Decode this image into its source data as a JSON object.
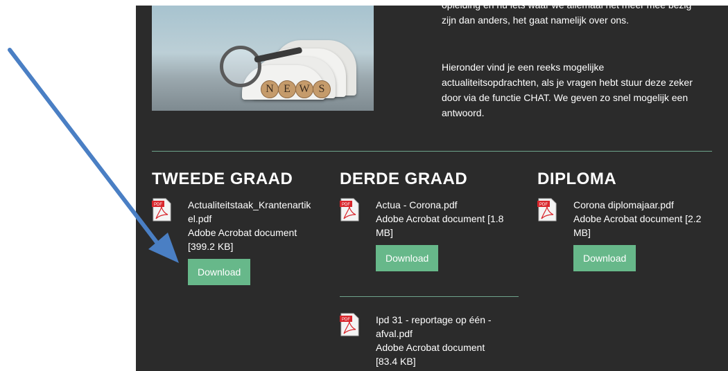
{
  "intro": {
    "line0": "opleiding en nu iets waar we allemaal het meer mee bezig",
    "line1": "zijn dan anders, het gaat namelijk over ons.",
    "para2_lines": [
      "Hieronder vind je een reeks mogelijke",
      "actualiteitsopdrachten, als je vragen hebt stuur deze zeker",
      "door via de functie CHAT. We geven zo snel mogelijk een",
      "antwoord."
    ]
  },
  "hero": {
    "letters": [
      "N",
      "E",
      "W",
      "S"
    ]
  },
  "columns": [
    {
      "title": "TWEEDE GRAAD",
      "files": [
        {
          "name_lines": [
            "Actualiteitstaak_Krantenartik",
            "el.pdf"
          ],
          "type_lines": [
            "Adobe Acrobat document",
            "[399.2 KB]"
          ],
          "button": "Download"
        }
      ]
    },
    {
      "title": "DERDE GRAAD",
      "files": [
        {
          "name_lines": [
            "Actua - Corona.pdf"
          ],
          "type_lines": [
            "Adobe Acrobat document [1.8",
            "MB]"
          ],
          "button": "Download"
        },
        {
          "name_lines": [
            "Ipd 31 - reportage op één -",
            "afval.pdf"
          ],
          "type_lines": [
            "Adobe Acrobat document",
            "[83.4 KB]"
          ],
          "button": ""
        }
      ]
    },
    {
      "title": "DIPLOMA",
      "files": [
        {
          "name_lines": [
            "Corona diplomajaar.pdf"
          ],
          "type_lines": [
            "Adobe Acrobat document [2.2",
            "MB]"
          ],
          "button": "Download"
        }
      ]
    }
  ],
  "pdf_icon_label": "PDF",
  "colors": {
    "panel": "#2b2b2b",
    "button": "#67b88a",
    "divider": "#6fa58d",
    "arrow": "#4a7fc4"
  }
}
